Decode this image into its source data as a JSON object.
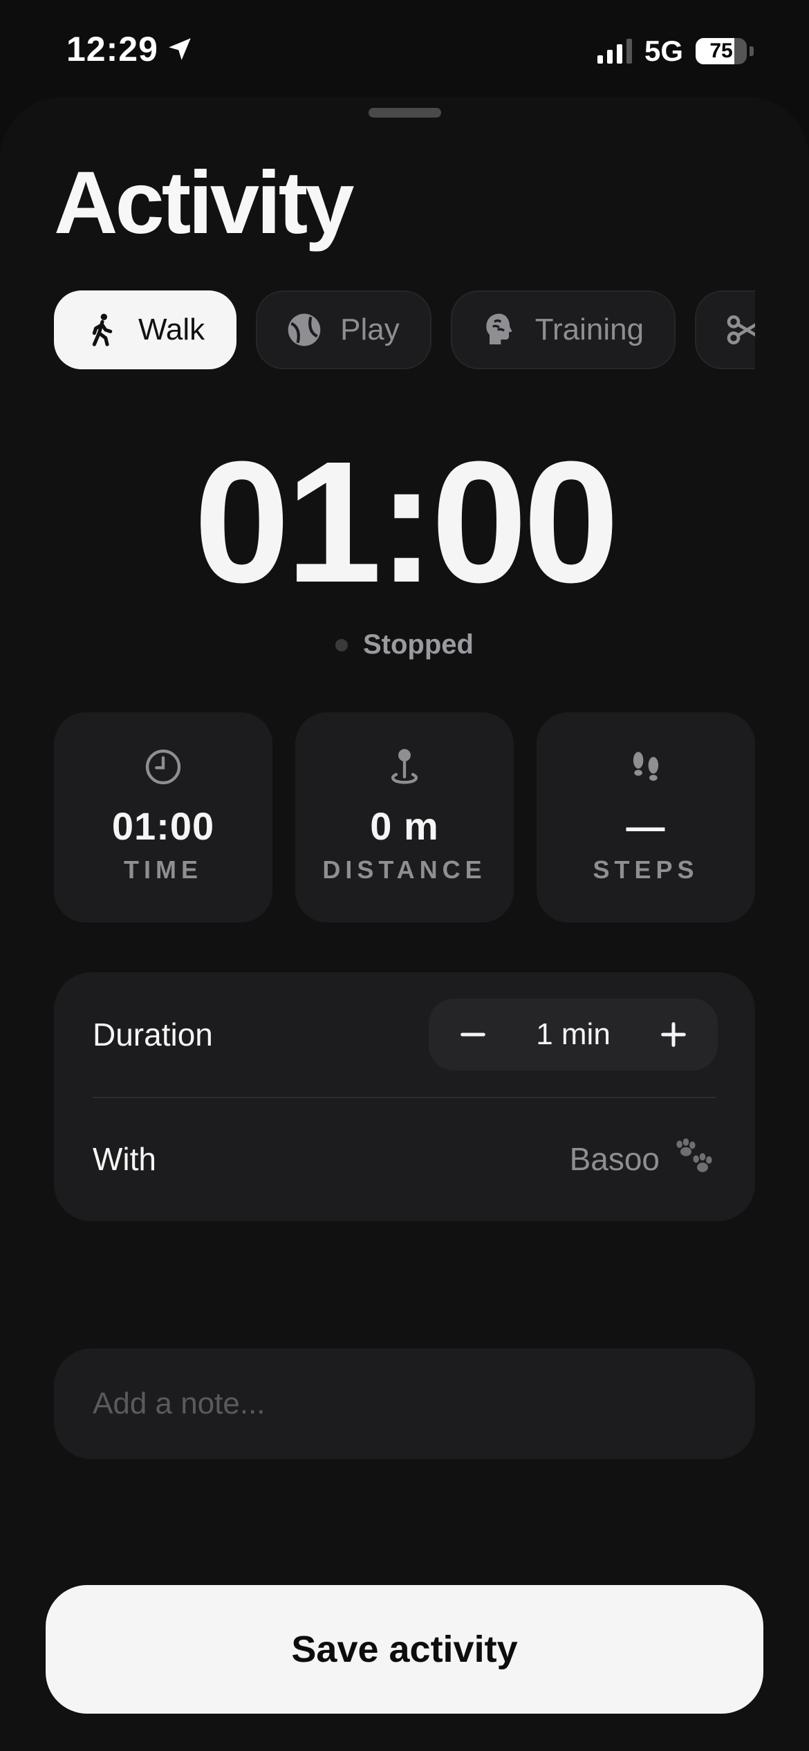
{
  "status_bar": {
    "time": "12:29",
    "location_icon": "location-arrow-icon",
    "network": "5G",
    "battery_percent": 75,
    "battery_label": "75",
    "signal_bars_active": 3,
    "signal_bars_total": 4
  },
  "page": {
    "title": "Activity"
  },
  "chips": [
    {
      "label": "Walk",
      "icon": "walk-icon",
      "active": true
    },
    {
      "label": "Play",
      "icon": "ball-icon",
      "active": false
    },
    {
      "label": "Training",
      "icon": "brain-head-icon",
      "active": false
    },
    {
      "label": "",
      "icon": "scissors-icon",
      "active": false
    }
  ],
  "timer": {
    "value": "01:00",
    "status": "Stopped"
  },
  "stats": [
    {
      "icon": "clock-icon",
      "value": "01:00",
      "label": "TIME"
    },
    {
      "icon": "pin-icon",
      "value": "0 m",
      "label": "DISTANCE"
    },
    {
      "icon": "footprints-icon",
      "value": "—",
      "label": "STEPS"
    }
  ],
  "settings": {
    "duration_label": "Duration",
    "duration_value": "1 min",
    "with_label": "With",
    "with_value": "Basoo"
  },
  "note": {
    "placeholder": "Add a note..."
  },
  "save_button": {
    "label": "Save activity"
  },
  "colors": {
    "background": "#0d0d0d",
    "sheet": "#111111",
    "card": "#1c1c1e",
    "active_chip": "#f5f5f5",
    "muted_text": "#8e8e93"
  }
}
